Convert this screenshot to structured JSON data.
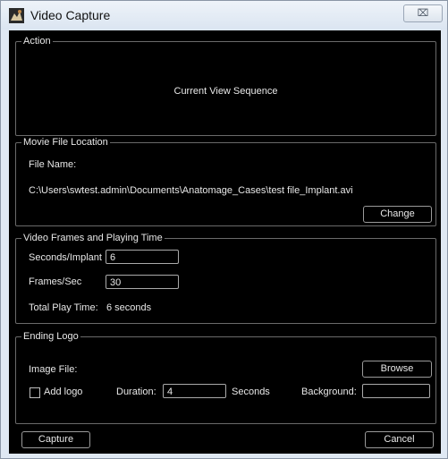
{
  "window": {
    "title": "Video Capture",
    "close_glyph": "⌧"
  },
  "action": {
    "legend": "Action",
    "value": "Current View Sequence"
  },
  "movie": {
    "legend": "Movie File Location",
    "file_name_label": "File Name:",
    "path": "C:\\Users\\swtest.admin\\Documents\\Anatomage_Cases\\test file_Implant.avi",
    "change_label": "Change"
  },
  "frames": {
    "legend": "Video Frames and Playing Time",
    "seconds_label": "Seconds/Implant",
    "seconds_value": "6",
    "fps_label": "Frames/Sec",
    "fps_value": "30",
    "total_label": "Total Play Time:",
    "total_value": "6 seconds"
  },
  "logo": {
    "legend": "Ending Logo",
    "image_file_label": "Image File:",
    "browse_label": "Browse",
    "add_logo_label": "Add logo",
    "add_logo_checked": false,
    "duration_label": "Duration:",
    "duration_value": "4",
    "seconds_label": "Seconds",
    "background_label": "Background:",
    "background_value": ""
  },
  "footer": {
    "capture_label": "Capture",
    "cancel_label": "Cancel"
  },
  "icons": {
    "app": "video-capture-app-icon",
    "close": "close-icon"
  },
  "colors": {
    "panel_bg": "#000000",
    "text": "#e8e8e8",
    "frame": "#dfe8f3",
    "border": "#6a6a6a"
  }
}
